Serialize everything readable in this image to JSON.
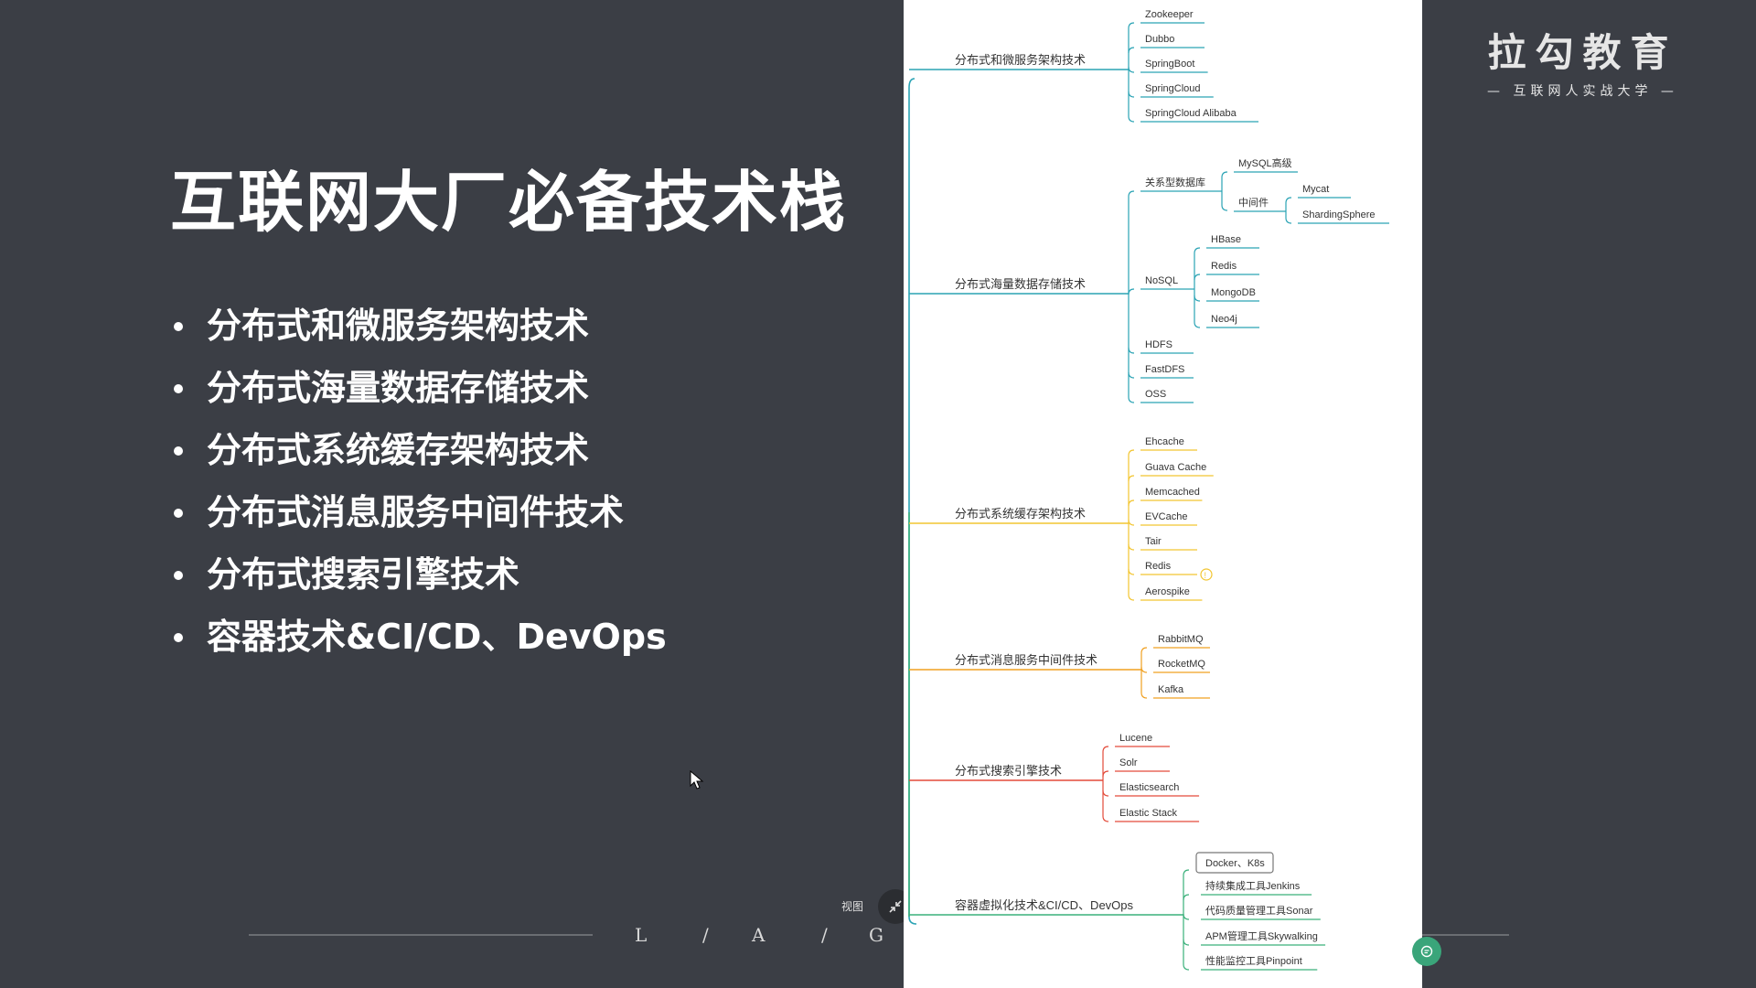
{
  "slide": {
    "title": "互联网大厂必备技术栈",
    "bullets": [
      "分布式和微服务架构技术",
      "分布式海量数据存储技术",
      "分布式系统缓存架构技术",
      "分布式消息服务中间件技术",
      "分布式搜索引擎技术",
      "容器技术&CI/CD、DevOps"
    ]
  },
  "brand": {
    "name": "拉勾教育",
    "slogan": "— 互联网人实战大学 —"
  },
  "footer": {
    "letters": [
      "L",
      "/",
      "A",
      "/",
      "G"
    ]
  },
  "view": {
    "label": "视图"
  },
  "colors": {
    "background": "#3b3e45",
    "teal": "#2aa3b4",
    "yellow": "#f2c530",
    "orange": "#f0a020",
    "red": "#e34a3a",
    "green": "#3ab07a"
  },
  "mindmap": {
    "branches": [
      {
        "label": "分布式和微服务架构技术",
        "color": "#2aa3b4",
        "children": [
          {
            "label": "Zookeeper"
          },
          {
            "label": "Dubbo"
          },
          {
            "label": "SpringBoot"
          },
          {
            "label": "SpringCloud"
          },
          {
            "label": "SpringCloud Alibaba"
          }
        ]
      },
      {
        "label": "分布式海量数据存储技术",
        "color": "#2aa3b4",
        "children": [
          {
            "label": "关系型数据库",
            "children": [
              {
                "label": "MySQL高级"
              },
              {
                "label": "中间件",
                "children": [
                  {
                    "label": "Mycat"
                  },
                  {
                    "label": "ShardingSphere"
                  }
                ]
              }
            ]
          },
          {
            "label": "NoSQL",
            "children": [
              {
                "label": "HBase"
              },
              {
                "label": "Redis"
              },
              {
                "label": "MongoDB"
              },
              {
                "label": "Neo4j"
              }
            ]
          },
          {
            "label": "HDFS"
          },
          {
            "label": "FastDFS"
          },
          {
            "label": "OSS"
          }
        ]
      },
      {
        "label": "分布式系统缓存架构技术",
        "color": "#f2c530",
        "children": [
          {
            "label": "Ehcache"
          },
          {
            "label": "Guava Cache"
          },
          {
            "label": "Memcached"
          },
          {
            "label": "EVCache"
          },
          {
            "label": "Tair"
          },
          {
            "label": "Redis",
            "badge": "!"
          },
          {
            "label": "Aerospike"
          }
        ]
      },
      {
        "label": "分布式消息服务中间件技术",
        "color": "#f0a020",
        "children": [
          {
            "label": "RabbitMQ"
          },
          {
            "label": "RocketMQ"
          },
          {
            "label": "Kafka"
          }
        ]
      },
      {
        "label": "分布式搜索引擎技术",
        "color": "#e34a3a",
        "children": [
          {
            "label": "Lucene"
          },
          {
            "label": "Solr"
          },
          {
            "label": "Elasticsearch"
          },
          {
            "label": "Elastic Stack"
          }
        ]
      },
      {
        "label": "容器虚拟化技术&CI/CD、DevOps",
        "color": "#3ab07a",
        "children": [
          {
            "label": "Docker、K8s",
            "boxed": true
          },
          {
            "label": "持续集成工具Jenkins"
          },
          {
            "label": "代码质量管理工具Sonar"
          },
          {
            "label": "APM管理工具Skywalking"
          },
          {
            "label": "性能监控工具Pinpoint"
          }
        ]
      }
    ]
  }
}
